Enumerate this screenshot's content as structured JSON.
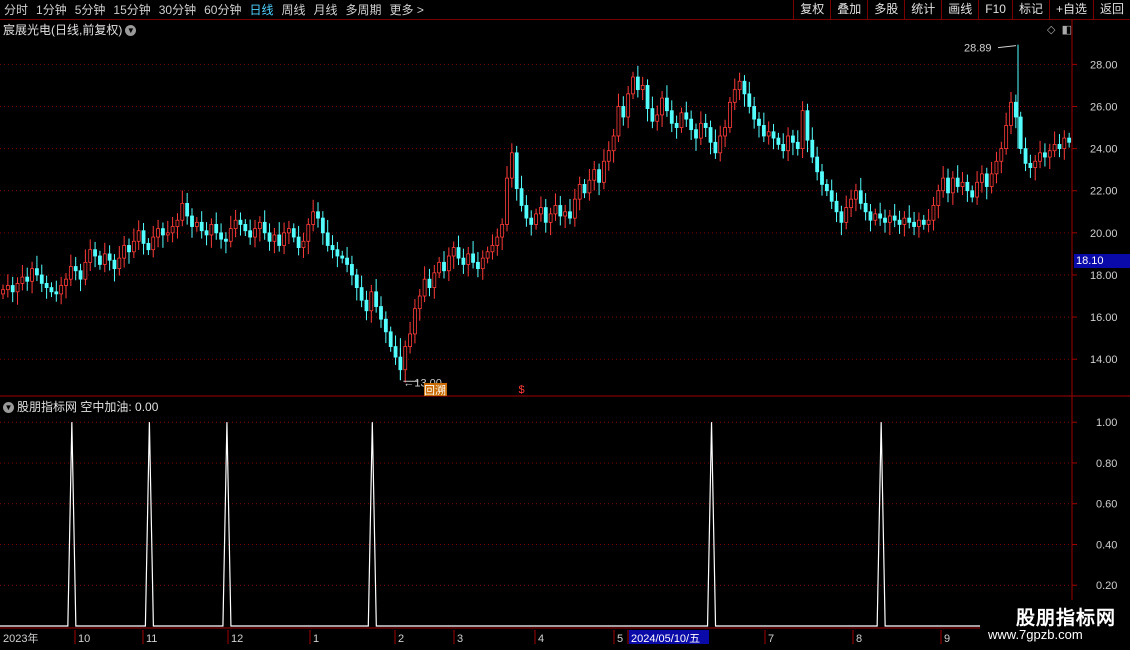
{
  "toolbar": {
    "periods": [
      "分时",
      "1分钟",
      "5分钟",
      "15分钟",
      "30分钟",
      "60分钟",
      "日线",
      "周线",
      "月线",
      "多周期",
      "更多 >"
    ],
    "active_period": "日线",
    "actions": [
      "复权",
      "叠加",
      "多股",
      "统计",
      "画线",
      "F10",
      "标记",
      "+自选",
      "返回"
    ]
  },
  "chart_title": "宸展光电(日线,前复权)",
  "price_axis": {
    "labels": [
      "28.00",
      "26.00",
      "24.00",
      "22.00",
      "20.00",
      "18.00",
      "16.00",
      "14.00"
    ],
    "current_price": "18.10"
  },
  "annotations": {
    "high_label": "28.89",
    "low_label": "13.00",
    "low_badge": "回",
    "low_badge_2": "溯",
    "signal_mark": "$"
  },
  "indicator": {
    "title": "股朋指标网",
    "line_label": "空中加油: 0.00",
    "axis_labels": [
      "1.00",
      "0.80",
      "0.60",
      "0.40",
      "0.20"
    ]
  },
  "date_axis": {
    "labels": [
      "2023年",
      "10",
      "11",
      "12",
      "1",
      "2",
      "3",
      "4",
      "5",
      "2024/05/10/五",
      "7",
      "8",
      "9"
    ]
  },
  "watermark": {
    "line1": "股朋指标网",
    "line2": "www.7gpzb.com"
  },
  "chart_data": {
    "type": "candlestick",
    "ylim": [
      12.3,
      29.3
    ],
    "price_ticks": [
      14,
      16,
      18,
      20,
      22,
      24,
      26,
      28
    ],
    "high": 28.89,
    "low": 13.0,
    "current_price": 18.1,
    "closes": [
      17.3,
      17.5,
      17.2,
      17.6,
      17.9,
      17.7,
      18.3,
      18.0,
      17.6,
      17.4,
      17.2,
      17.1,
      17.5,
      17.8,
      18.4,
      18.2,
      17.8,
      18.6,
      19.2,
      18.9,
      18.5,
      19.0,
      18.7,
      18.3,
      18.8,
      19.4,
      19.1,
      19.6,
      20.1,
      19.5,
      19.2,
      19.8,
      20.2,
      19.9,
      20.0,
      20.3,
      20.6,
      21.4,
      20.8,
      20.3,
      20.5,
      20.1,
      19.9,
      20.4,
      20.0,
      19.7,
      19.6,
      20.2,
      20.6,
      20.4,
      20.1,
      19.8,
      20.2,
      20.5,
      20.0,
      19.6,
      19.9,
      19.4,
      20.0,
      20.2,
      19.8,
      19.3,
      19.6,
      20.4,
      21.0,
      20.7,
      20.0,
      19.4,
      19.2,
      18.9,
      18.8,
      18.5,
      18.0,
      17.4,
      16.8,
      16.3,
      17.2,
      16.5,
      15.9,
      15.3,
      14.6,
      14.1,
      13.5,
      14.6,
      15.2,
      16.4,
      17.0,
      17.8,
      17.4,
      18.1,
      18.6,
      18.2,
      18.9,
      19.3,
      18.8,
      18.5,
      19.0,
      18.6,
      18.3,
      18.8,
      19.1,
      19.4,
      19.8,
      20.4,
      22.6,
      23.8,
      22.1,
      21.3,
      20.7,
      20.4,
      20.9,
      21.2,
      20.5,
      20.9,
      21.3,
      20.8,
      21.0,
      20.7,
      21.6,
      22.3,
      21.9,
      22.5,
      23.0,
      22.4,
      23.4,
      23.9,
      24.6,
      26.0,
      25.5,
      26.6,
      27.4,
      26.8,
      27.0,
      25.9,
      25.3,
      25.6,
      26.4,
      25.8,
      25.2,
      25.0,
      25.7,
      25.4,
      24.9,
      24.5,
      25.2,
      25.0,
      24.3,
      23.8,
      24.6,
      25.0,
      26.2,
      26.8,
      27.2,
      26.6,
      26.0,
      25.4,
      25.1,
      24.6,
      24.8,
      24.5,
      24.2,
      23.9,
      24.6,
      24.3,
      24.0,
      25.8,
      24.4,
      23.6,
      22.9,
      22.3,
      22.0,
      21.5,
      21.0,
      20.5,
      21.2,
      21.6,
      22.0,
      21.4,
      21.0,
      20.6,
      20.9,
      20.7,
      20.5,
      20.8,
      20.6,
      20.4,
      20.7,
      20.5,
      20.3,
      20.6,
      20.4,
      20.6,
      21.3,
      22.0,
      22.6,
      21.9,
      22.6,
      22.2,
      22.4,
      22.0,
      21.7,
      22.4,
      22.8,
      22.2,
      22.8,
      23.4,
      24.0,
      25.1,
      26.2,
      25.5,
      24.0,
      23.3,
      23.1,
      23.4,
      23.8,
      23.6,
      23.9,
      24.2,
      24.0,
      24.5,
      24.3
    ],
    "indicator_peaks_at_candle_index": [
      14,
      30,
      46,
      76,
      146,
      181
    ],
    "indicator_peak_value": 1.0,
    "indicator_ylim": [
      0,
      1.05
    ],
    "indicator_ticks": [
      0.2,
      0.4,
      0.6,
      0.8,
      1.0
    ],
    "signal_candle_index": 107
  }
}
